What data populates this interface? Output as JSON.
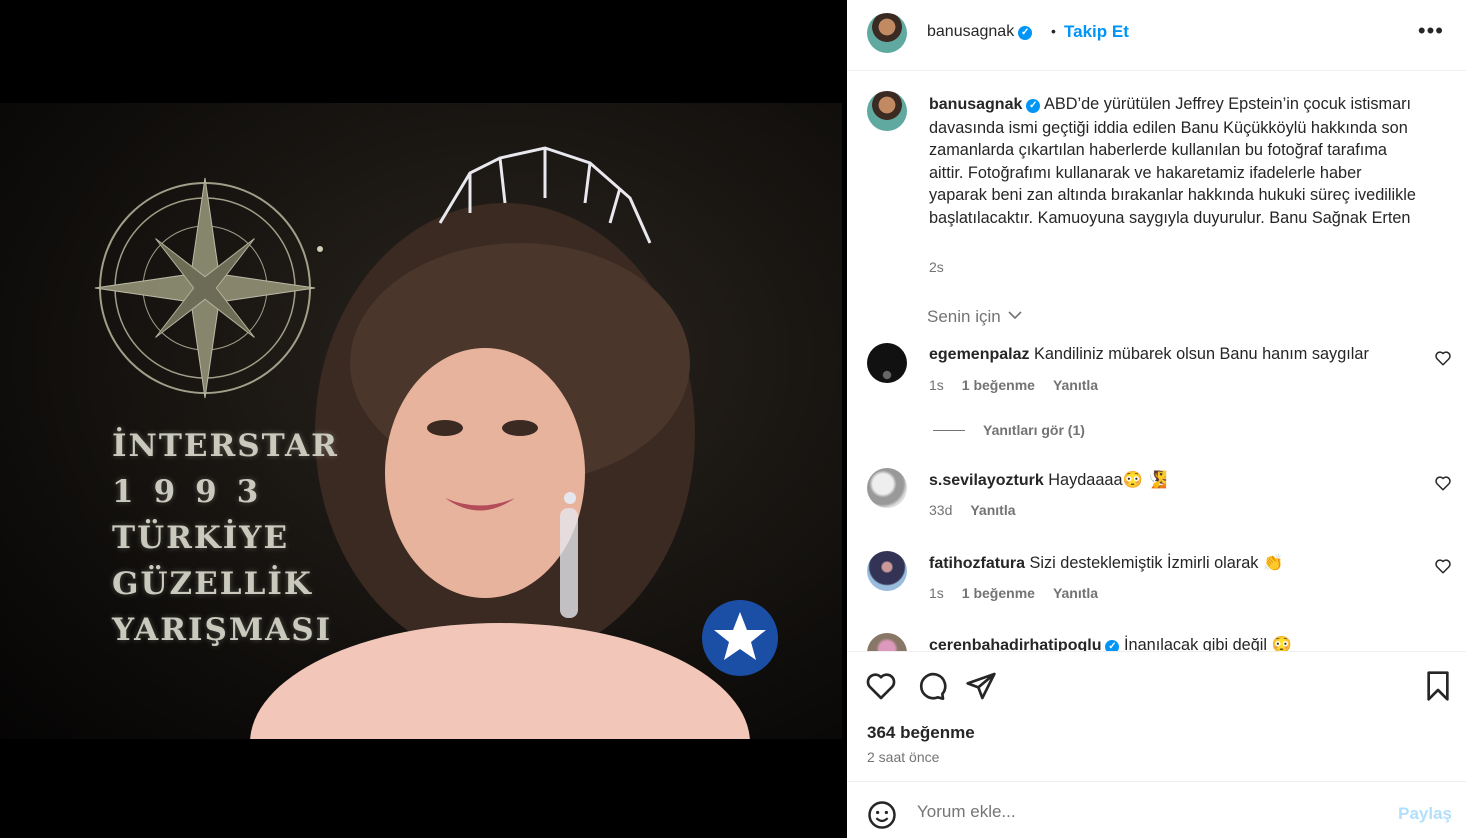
{
  "header": {
    "username": "banusagnak",
    "separator": "•",
    "follow_label": "Takip Et",
    "more_label": "•••"
  },
  "media": {
    "overlay_lines": [
      "İNTERSTAR",
      "1993",
      "TÜRKİYE",
      "GÜZELLİK",
      "YARIŞMASI"
    ]
  },
  "post": {
    "username": "banusagnak",
    "caption": "ABD’de yürütülen Jeffrey Epstein’in çocuk istismarı davasında ismi geçtiği iddia edilen Banu Küçükköylü hakkında son zamanlarda çıkartılan haberlerde kullanılan bu fotoğraf tarafıma aittir. Fotoğrafımı kullanarak ve hakaretamiz ifadelerle haber yaparak beni zan altında bırakanlar hakkında hukuki süreç ivedilikle başlatılacaktır. Kamuoyuna saygıyla duyurulur. Banu Sağnak Erten",
    "time": "2s",
    "sort_label": "Senin için"
  },
  "comments": [
    {
      "username": "egemenpalaz",
      "text": "Kandiliniz mübarek olsun Banu hanım saygılar",
      "time": "1s",
      "likes": "1 beğenme",
      "reply": "Yanıtla"
    },
    {
      "username": "s.sevilayozturk",
      "text": "Haydaaaa😳 🧏",
      "time": "33d",
      "likes": "",
      "reply": "Yanıtla"
    },
    {
      "username": "fatihozfatura",
      "text": "Sizi desteklemiştik İzmirli olarak 👏",
      "time": "1s",
      "likes": "1 beğenme",
      "reply": "Yanıtla"
    },
    {
      "username": "cerenbahadirhatipoglu",
      "text": "İnanılacak gibi değil 😳",
      "time": "",
      "likes": "",
      "reply": ""
    }
  ],
  "replies_label": "Yanıtları gör (1)",
  "footer": {
    "likes": "364 beğenme",
    "posted_ago": "2 saat önce",
    "comment_placeholder": "Yorum ekle...",
    "share_label": "Paylaş"
  },
  "colors": {
    "accent": "#0095f6",
    "secondary_text": "#737373",
    "share_disabled": "#b2dffc"
  }
}
